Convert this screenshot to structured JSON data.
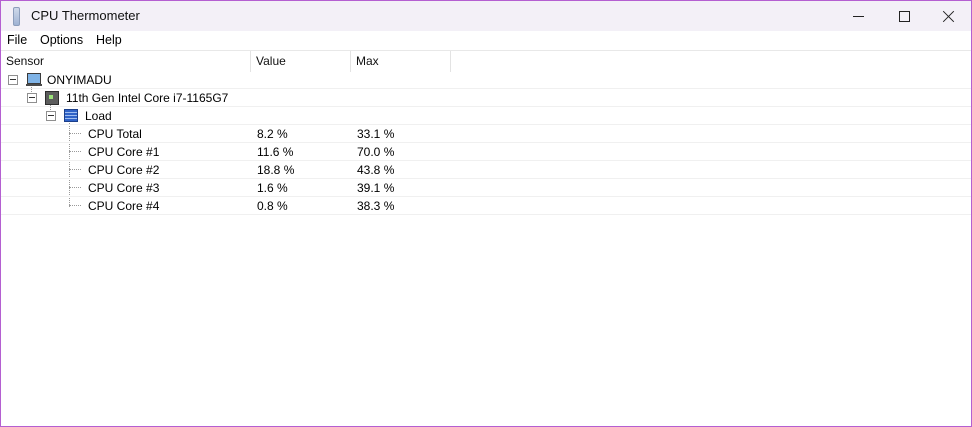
{
  "window": {
    "title": "CPU Thermometer"
  },
  "menu": {
    "items": [
      "File",
      "Options",
      "Help"
    ]
  },
  "columns": {
    "sensor": "Sensor",
    "value": "Value",
    "max": "Max"
  },
  "tree": {
    "computer": "ONYIMADU",
    "cpu": "11th Gen Intel Core i7-1165G7",
    "group": "Load",
    "sensors": [
      {
        "name": "CPU Total",
        "value": "8.2 %",
        "max": "33.1 %"
      },
      {
        "name": "CPU Core #1",
        "value": "11.6 %",
        "max": "70.0 %"
      },
      {
        "name": "CPU Core #2",
        "value": "18.8 %",
        "max": "43.8 %"
      },
      {
        "name": "CPU Core #3",
        "value": "1.6 %",
        "max": "39.1 %"
      },
      {
        "name": "CPU Core #4",
        "value": "0.8 %",
        "max": "38.3 %"
      }
    ]
  },
  "icons": {
    "app": "thermometer-icon",
    "computer": "computer-icon",
    "cpu": "cpu-chip-icon",
    "load": "load-bars-icon"
  },
  "colors": {
    "window_border": "#b45fd1",
    "titlebar_bg": "#f3f0f7"
  }
}
